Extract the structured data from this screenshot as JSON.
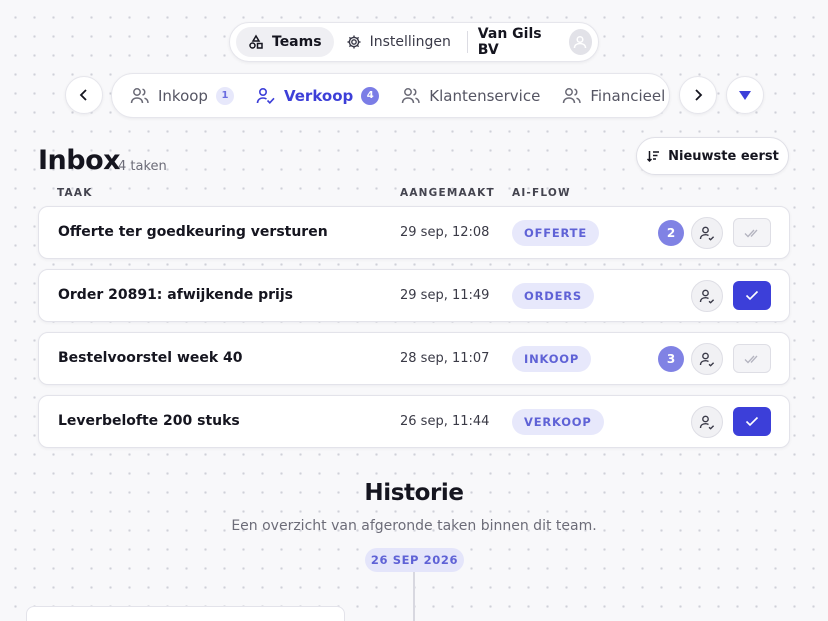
{
  "topnav": {
    "teams_label": "Teams",
    "settings_label": "Instellingen",
    "company": "Van Gils BV"
  },
  "team_tabs": [
    {
      "label": "Inkoop",
      "count": "1",
      "active": false
    },
    {
      "label": "Verkoop",
      "count": "4",
      "active": true
    },
    {
      "label": "Klantenservice",
      "count": "",
      "active": false
    },
    {
      "label": "Financieel",
      "count": "",
      "active": false
    }
  ],
  "inbox": {
    "title": "Inbox",
    "count_text": "4 taken",
    "sort_label": "Nieuwste eerst",
    "columns": {
      "task": "TAAK",
      "created": "AANGEMAAKT",
      "flow": "AI-FLOW"
    },
    "tasks": [
      {
        "title": "Offerte ter goedkeuring versturen",
        "created": "29 sep, 12:08",
        "flow": "OFFERTE",
        "badge": "2",
        "approve_state": "muted"
      },
      {
        "title": "Order 20891: afwijkende prijs",
        "created": "29 sep, 11:49",
        "flow": "ORDERS",
        "badge": "",
        "approve_state": "primary"
      },
      {
        "title": "Bestelvoorstel week 40",
        "created": "28 sep, 11:07",
        "flow": "INKOOP",
        "badge": "3",
        "approve_state": "muted"
      },
      {
        "title": "Leverbelofte 200 stuks",
        "created": "26 sep, 11:44",
        "flow": "VERKOOP",
        "badge": "",
        "approve_state": "primary"
      }
    ]
  },
  "history": {
    "title": "Historie",
    "subtitle": "Een overzicht van afgeronde taken binnen dit team.",
    "date_label": "26 SEP 2026"
  },
  "colors": {
    "accent": "#3c3fd9",
    "accent_soft": "#e7e8fb",
    "badge": "#8082e4"
  },
  "icons": {
    "teams": "shapes-icon",
    "settings": "gear-icon",
    "avatar": "user-icon",
    "prev": "chevron-left-icon",
    "next": "chevron-right-icon",
    "dropdown": "triangle-down-icon",
    "team": "users-icon",
    "active_team": "user-check-icon",
    "sort": "sort-descending-icon",
    "assign": "user-assign-icon",
    "approve": "check-icon",
    "approve_all": "double-check-icon"
  }
}
